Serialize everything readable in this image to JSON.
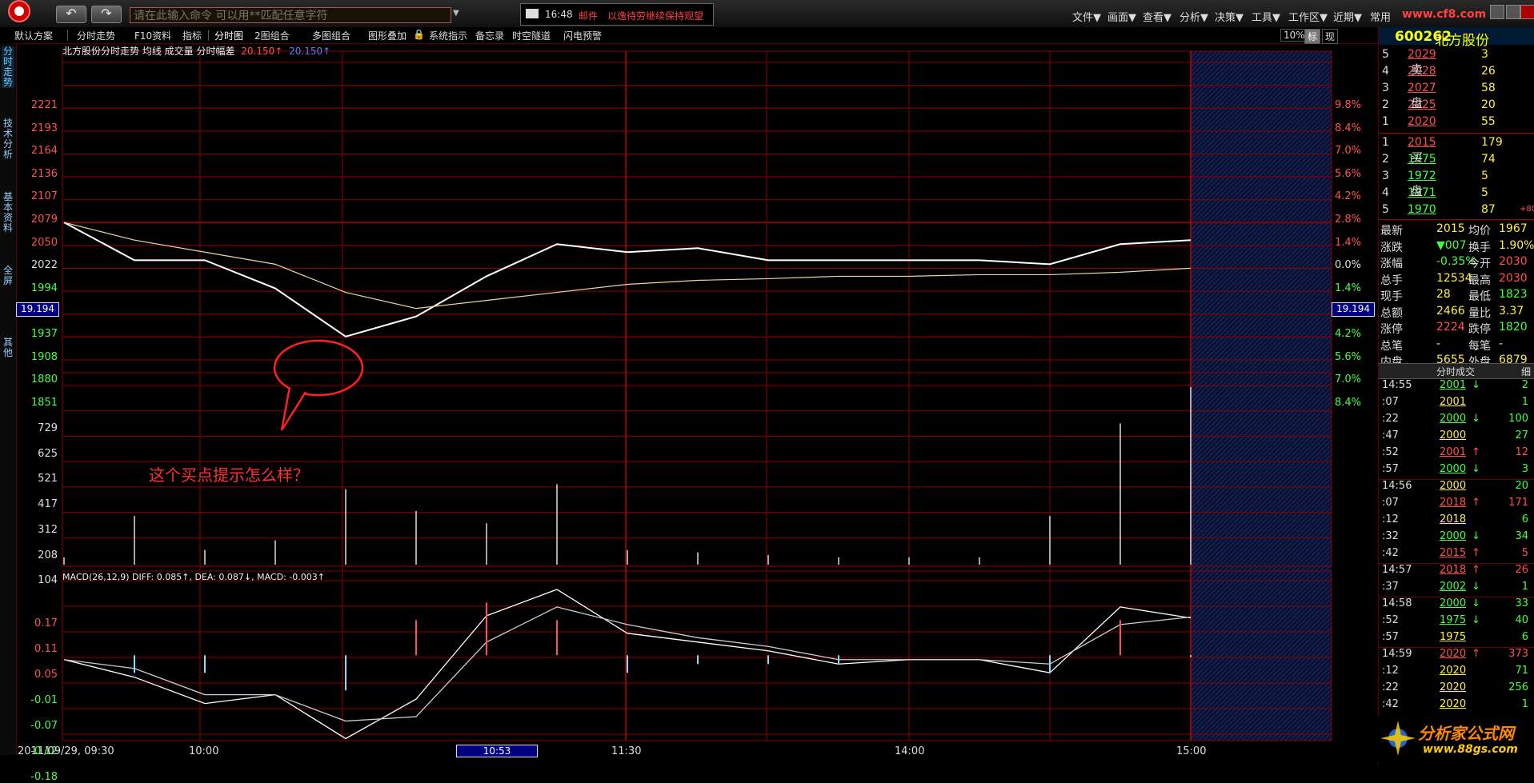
{
  "app": {
    "command_placeholder": "请在此输入命令   可以用**匹配任意字符",
    "mail_time": "16:48",
    "mail_label": "邮件",
    "mail_text": "以逸待劳继续保持观望",
    "menu": [
      "文件▼",
      "画面▼",
      "查看▼",
      "分析▼",
      "决策▼",
      "工具▼",
      "工作区▼",
      "近期▼",
      "常用"
    ],
    "brand_text": "www.cf8.com"
  },
  "toolbar": {
    "items": [
      "默认方案",
      "分时走势",
      "F10资料",
      "指标",
      "分时图",
      "2图组合",
      "多图组合",
      "图形叠加",
      "系统指示",
      "备忘录",
      "时空隧道",
      "闪电预警"
    ],
    "right": [
      "10%",
      "标",
      "现"
    ]
  },
  "left_tabs": [
    "分时走势",
    "技术分析",
    "基本资料",
    "全屏",
    "其他"
  ],
  "chart": {
    "title": "北方股份分时走势 均线 成交量 分时幅差",
    "title_value1": "20.150↑",
    "title_value2": "20.150↑",
    "price_ticks": [
      "2221",
      "2193",
      "2164",
      "2136",
      "2107",
      "2079",
      "2050",
      "2022",
      "1994",
      "1965",
      "1937",
      "1908",
      "1880",
      "1851"
    ],
    "pct_ticks": [
      "9.8%",
      "8.4%",
      "7.0%",
      "5.6%",
      "4.2%",
      "2.8%",
      "1.4%",
      "0.0%",
      "1.4%",
      "2.8%",
      "4.2%",
      "5.6%",
      "7.0%",
      "8.4%"
    ],
    "volume_ticks": [
      "729",
      "625",
      "521",
      "417",
      "312",
      "208",
      "104"
    ],
    "macd_ticks": [
      "0.17",
      "0.11",
      "0.05",
      "-0.01",
      "-0.07",
      "-0.12",
      "-0.18"
    ],
    "macd_title": "MACD(26,12,9)  DIFF: 0.085↑, DEA: 0.087↓, MACD: -0.003↑",
    "cursor_price": "19.194",
    "x_ticks": [
      "2011/09/29, 09:30",
      "10:00",
      "10:53",
      "11:30",
      "14:00",
      "15:00"
    ],
    "annotation": "这个买点提示怎么样？",
    "colors": {
      "grid": "#8b0000",
      "price_line": "#ffffff",
      "avg_line": "#e8d8a0",
      "annotation": "#ff3030"
    }
  },
  "chart_data": [
    {
      "type": "line",
      "title": "北方股份分时走势",
      "ylim": [
        1851,
        2221
      ],
      "x": [
        "09:30",
        "09:45",
        "10:00",
        "10:15",
        "10:30",
        "10:45",
        "11:00",
        "11:15",
        "11:30",
        "13:15",
        "13:30",
        "13:45",
        "14:00",
        "14:15",
        "14:30",
        "14:45",
        "15:00"
      ],
      "series": [
        {
          "name": "",
          "values": [
            2022,
            1975,
            1975,
            1940,
            1880,
            1905,
            1955,
            1995,
            1985,
            1990,
            1975,
            1975,
            1975,
            1975,
            1970,
            1995,
            2000
          ]
        },
        {
          "name": "均线",
          "values": [
            2022,
            2000,
            1985,
            1970,
            1935,
            1915,
            1925,
            1935,
            1945,
            1950,
            1952,
            1955,
            1955,
            1957,
            1957,
            1960,
            1965
          ]
        }
      ]
    },
    {
      "type": "bar",
      "title": "成交量",
      "ylim": [
        0,
        729
      ],
      "x": [
        "09:30",
        "09:45",
        "10:00",
        "10:15",
        "10:30",
        "10:45",
        "11:00",
        "11:15",
        "11:30",
        "13:15",
        "13:30",
        "13:45",
        "14:00",
        "14:15",
        "14:30",
        "14:45",
        "15:00"
      ],
      "values": [
        30,
        200,
        60,
        100,
        310,
        220,
        170,
        330,
        60,
        50,
        40,
        30,
        30,
        30,
        200,
        580,
        729
      ]
    },
    {
      "type": "line",
      "title": "MACD(26,12,9)",
      "ylim": [
        -0.18,
        0.17
      ],
      "x": [
        "09:30",
        "09:45",
        "10:00",
        "10:15",
        "10:30",
        "10:45",
        "11:00",
        "11:15",
        "11:30",
        "13:15",
        "13:30",
        "13:45",
        "14:00",
        "14:15",
        "14:30",
        "14:45",
        "15:00"
      ],
      "series": [
        {
          "name": "DIFF",
          "values": [
            -0.01,
            -0.05,
            -0.11,
            -0.09,
            -0.19,
            -0.1,
            0.09,
            0.15,
            0.05,
            0.03,
            0.01,
            -0.02,
            -0.01,
            -0.01,
            -0.04,
            0.11,
            0.085
          ]
        },
        {
          "name": "DEA",
          "values": [
            -0.01,
            -0.03,
            -0.09,
            -0.09,
            -0.15,
            -0.14,
            0.03,
            0.11,
            0.07,
            0.04,
            0.02,
            -0.01,
            -0.01,
            -0.01,
            -0.02,
            0.07,
            0.087
          ]
        }
      ]
    }
  ],
  "side": {
    "code": "600262",
    "name": "北方股份",
    "sell_label": [
      "卖",
      "盘"
    ],
    "buy_label": [
      "买",
      "盘"
    ],
    "sells": [
      {
        "lvl": "5",
        "price": "2029",
        "vol": "3"
      },
      {
        "lvl": "4",
        "price": "2028",
        "vol": "26"
      },
      {
        "lvl": "3",
        "price": "2027",
        "vol": "58"
      },
      {
        "lvl": "2",
        "price": "2025",
        "vol": "20"
      },
      {
        "lvl": "1",
        "price": "2020",
        "vol": "55"
      }
    ],
    "buys": [
      {
        "lvl": "1",
        "price": "2015",
        "vol": "179"
      },
      {
        "lvl": "2",
        "price": "1975",
        "vol": "74"
      },
      {
        "lvl": "3",
        "price": "1972",
        "vol": "5"
      },
      {
        "lvl": "4",
        "price": "1971",
        "vol": "5"
      },
      {
        "lvl": "5",
        "price": "1970",
        "vol": "87"
      }
    ],
    "extra": "+80",
    "quotes": [
      {
        "l1": "最新",
        "v1": "2015",
        "l2": "均价",
        "v2": "1967"
      },
      {
        "l1": "涨跌",
        "v1": "▼007",
        "l2": "换手",
        "v2": "1.90%"
      },
      {
        "l1": "涨幅",
        "v1": "-0.35%",
        "l2": "今开",
        "v2": "2030"
      },
      {
        "l1": "总手",
        "v1": "12534",
        "l2": "最高",
        "v2": "2030"
      },
      {
        "l1": "现手",
        "v1": "28",
        "l2": "最低",
        "v2": "1823"
      },
      {
        "l1": "总额",
        "v1": "2466",
        "l2": "量比",
        "v2": "3.37"
      },
      {
        "l1": "涨停",
        "v1": "2224",
        "l2": "跌停",
        "v2": "1820"
      },
      {
        "l1": "总笔",
        "v1": "-",
        "l2": "每笔",
        "v2": "-"
      },
      {
        "l1": "内盘",
        "v1": "5655",
        "l2": "外盘",
        "v2": "6879"
      }
    ],
    "trade_head": "分时成交",
    "trade_tab": "细",
    "trades": [
      {
        "t": "14:55",
        "p": "2001",
        "d": "dn",
        "v": "2"
      },
      {
        "t": ":07",
        "p": "2001",
        "d": "",
        "v": "1"
      },
      {
        "t": ":22",
        "p": "2000",
        "d": "dn",
        "v": "100"
      },
      {
        "t": ":47",
        "p": "2000",
        "d": "",
        "v": "27"
      },
      {
        "t": ":52",
        "p": "2001",
        "d": "up",
        "v": "12"
      },
      {
        "t": ":57",
        "p": "2000",
        "d": "dn",
        "v": "3"
      },
      {
        "t": "14:56",
        "p": "2000",
        "d": "",
        "v": "20"
      },
      {
        "t": ":07",
        "p": "2018",
        "d": "up",
        "v": "171"
      },
      {
        "t": ":12",
        "p": "2018",
        "d": "",
        "v": "6"
      },
      {
        "t": ":32",
        "p": "2000",
        "d": "dn",
        "v": "34"
      },
      {
        "t": ":42",
        "p": "2015",
        "d": "up",
        "v": "5"
      },
      {
        "t": "14:57",
        "p": "2018",
        "d": "up",
        "v": "26"
      },
      {
        "t": ":37",
        "p": "2002",
        "d": "dn",
        "v": "1"
      },
      {
        "t": "14:58",
        "p": "2000",
        "d": "dn",
        "v": "33"
      },
      {
        "t": ":52",
        "p": "1975",
        "d": "dn",
        "v": "40"
      },
      {
        "t": ":57",
        "p": "1975",
        "d": "",
        "v": "6"
      },
      {
        "t": "14:59",
        "p": "2020",
        "d": "up",
        "v": "373"
      },
      {
        "t": ":12",
        "p": "2020",
        "d": "",
        "v": "71"
      },
      {
        "t": ":22",
        "p": "2020",
        "d": "",
        "v": "256"
      },
      {
        "t": ":42",
        "p": "2020",
        "d": "",
        "v": "1"
      }
    ],
    "wm1": "分析家公式网",
    "wm2": "www.88gs.com"
  }
}
